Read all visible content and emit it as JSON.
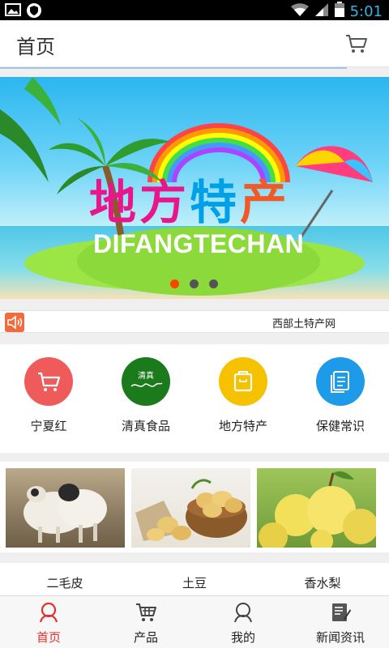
{
  "status_bar": {
    "time": "5:01"
  },
  "header": {
    "title": "首页"
  },
  "banner": {
    "title_chars": [
      "地",
      "方",
      "特",
      "产"
    ],
    "subtitle": "DIFANGTECHAN",
    "dot_count": 3,
    "active_dot": 1
  },
  "notice": {
    "text": "西部土特产网"
  },
  "categories": [
    {
      "label": "宁夏红",
      "icon": "cart-icon",
      "color": "#ef5b5b"
    },
    {
      "label": "清真食品",
      "icon": "halal-icon",
      "color": "#1b7a1b",
      "icon_text": "清真"
    },
    {
      "label": "地方特产",
      "icon": "bag-icon",
      "color": "#f6c200"
    },
    {
      "label": "保健常识",
      "icon": "document-icon",
      "color": "#1e9be8"
    }
  ],
  "products": [
    {
      "name": "二毛皮"
    },
    {
      "name": "土豆"
    },
    {
      "name": "香水梨"
    }
  ],
  "bottom_nav": [
    {
      "label": "首页",
      "icon": "home-icon",
      "active": true
    },
    {
      "label": "产品",
      "icon": "cart-icon",
      "active": false
    },
    {
      "label": "我的",
      "icon": "user-icon",
      "active": false
    },
    {
      "label": "新闻资讯",
      "icon": "news-icon",
      "active": false
    }
  ],
  "colors": {
    "active_nav": "#e23030",
    "dot_active": "#ff4400",
    "accent_blue": "#32b5e5"
  }
}
